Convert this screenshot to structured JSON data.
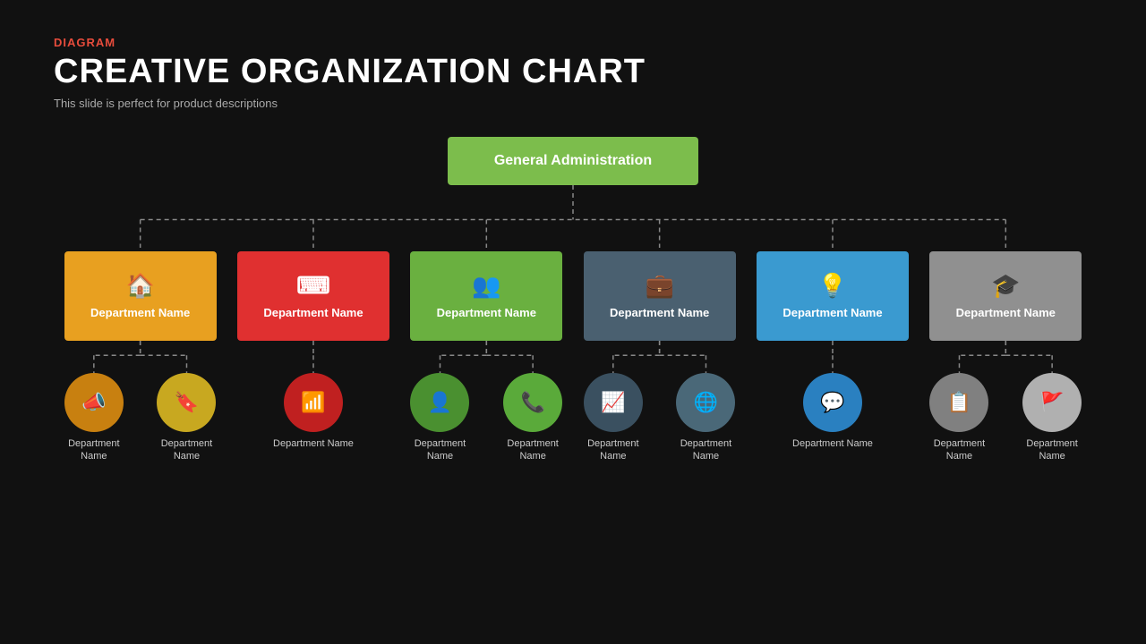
{
  "header": {
    "label": "Diagram",
    "title": "CREATIVE ORGANIZATION CHART",
    "subtitle": "This slide is perfect for product descriptions"
  },
  "topNode": {
    "label": "General Administration"
  },
  "departments": [
    {
      "name": "Department\nName",
      "color": "orange",
      "icon": "🏠",
      "subs": [
        {
          "icon": "📣",
          "color": "orange-dark",
          "name": "Department\nName"
        },
        {
          "icon": "🔖",
          "color": "gold",
          "name": "Department\nName"
        }
      ]
    },
    {
      "name": "Department\nName",
      "color": "red",
      "icon": "⌨",
      "subs": [
        {
          "icon": "📶",
          "color": "red-dark",
          "name": "Department\nName"
        }
      ]
    },
    {
      "name": "Department\nName",
      "color": "green",
      "icon": "👥",
      "subs": [
        {
          "icon": "👤",
          "color": "green-dark",
          "name": "Department\nName"
        },
        {
          "icon": "📞",
          "color": "green-med",
          "name": "Department\nName"
        }
      ]
    },
    {
      "name": "Department\nName",
      "color": "teal",
      "icon": "💼",
      "subs": [
        {
          "icon": "📈",
          "color": "teal-dark",
          "name": "Department\nName"
        },
        {
          "icon": "🌐",
          "color": "teal-med",
          "name": "Department\nName"
        }
      ]
    },
    {
      "name": "Department\nName",
      "color": "blue",
      "icon": "💡",
      "subs": [
        {
          "icon": "💬",
          "color": "blue-dark",
          "name": "Department\nName"
        }
      ]
    },
    {
      "name": "Department\nName",
      "color": "gray",
      "icon": "🎓",
      "subs": [
        {
          "icon": "📋",
          "color": "gray-light",
          "name": "Department\nName"
        },
        {
          "icon": "🚩",
          "color": "gray-dark",
          "name": "Department\nName"
        }
      ]
    }
  ]
}
